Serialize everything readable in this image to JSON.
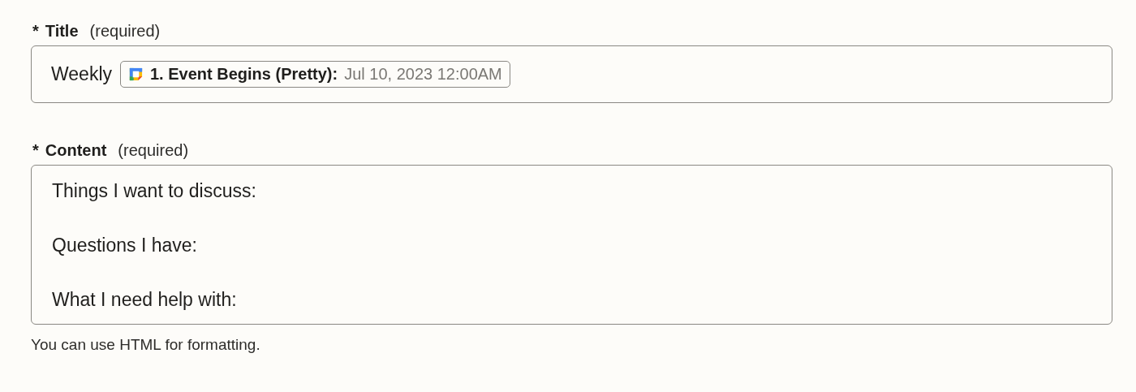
{
  "fields": [
    {
      "kind": "single",
      "required_mark": "*",
      "label": "Title",
      "note": "(required)",
      "value": "Weekly",
      "tokens": [
        {
          "step": "1. Event Begins (Pretty):",
          "sample": "Jul 10, 2023 12:00AM"
        }
      ]
    },
    {
      "kind": "multi",
      "required_mark": "*",
      "label": "Content",
      "note": "(required)",
      "lines": [
        "Things I want to discuss:",
        "Questions I have:",
        "What I need help with:"
      ],
      "hint": "You can use HTML for formatting."
    }
  ]
}
